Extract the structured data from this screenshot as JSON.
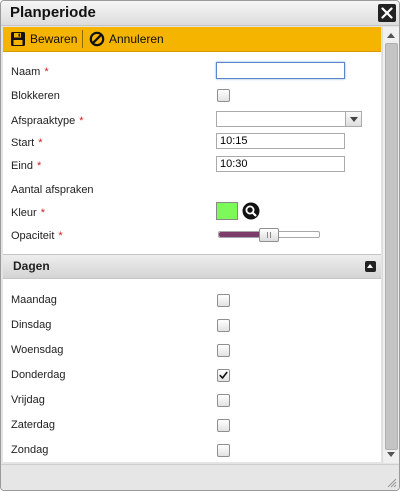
{
  "window": {
    "title": "Planperiode"
  },
  "toolbar": {
    "save_label": "Bewaren",
    "cancel_label": "Annuleren",
    "accent": "#f5b400"
  },
  "form": {
    "naam": {
      "label": "Naam",
      "required": "*",
      "value": ""
    },
    "blokkeren": {
      "label": "Blokkeren",
      "checked": false
    },
    "afspraaktype": {
      "label": "Afspraaktype",
      "required": "*",
      "value": ""
    },
    "start": {
      "label": "Start",
      "required": "*",
      "value": "10:15"
    },
    "eind": {
      "label": "Eind",
      "required": "*",
      "value": "10:30"
    },
    "aantal": {
      "label": "Aantal afspraken"
    },
    "kleur": {
      "label": "Kleur",
      "required": "*",
      "color": "#7dfa5a"
    },
    "opaciteit": {
      "label": "Opaciteit",
      "required": "*",
      "level": 0.5
    }
  },
  "dagen": {
    "title": "Dagen",
    "days": [
      {
        "label": "Maandag",
        "checked": false
      },
      {
        "label": "Dinsdag",
        "checked": false
      },
      {
        "label": "Woensdag",
        "checked": false
      },
      {
        "label": "Donderdag",
        "checked": true
      },
      {
        "label": "Vrijdag",
        "checked": false
      },
      {
        "label": "Zaterdag",
        "checked": false
      },
      {
        "label": "Zondag",
        "checked": false
      }
    ]
  }
}
